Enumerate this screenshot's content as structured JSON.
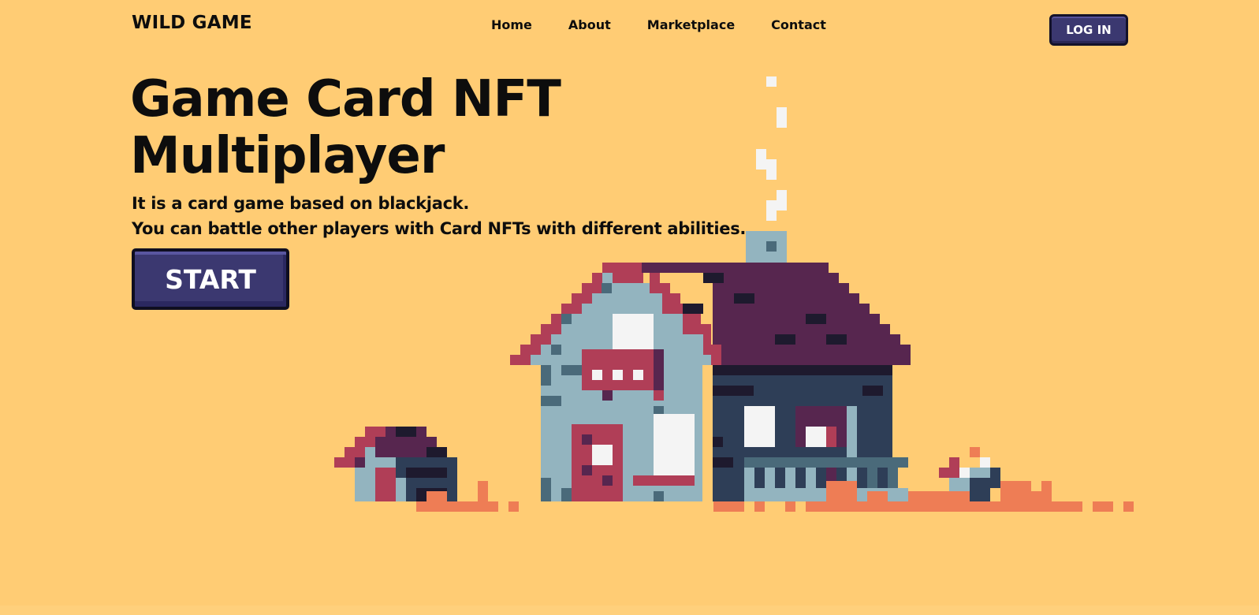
{
  "header": {
    "logo": "WILD GAME",
    "nav": [
      {
        "label": "Home"
      },
      {
        "label": "About"
      },
      {
        "label": "Marketplace"
      },
      {
        "label": "Contact"
      }
    ],
    "login_label": "LOG IN"
  },
  "hero": {
    "title_line1": "Game Card NFT",
    "title_line2": "Multiplayer",
    "desc_line1": "It is a card game based on blackjack.",
    "desc_line2": "You can battle other players with Card NFTs with different abilities.",
    "start_label": "START"
  },
  "illustration": {
    "name": "pixel-house-illustration",
    "colors": {
      "background": "#ffcc74",
      "roof": "#57264f",
      "roof_edge": "#b03e57",
      "wall_light": "#93b4bf",
      "wall_dark": "#2e3e57",
      "window": "#f4f4f4",
      "door": "#b03e57",
      "ground": "#ee7d55",
      "smoke": "#f4f4f4",
      "button": "#3b3870"
    }
  }
}
